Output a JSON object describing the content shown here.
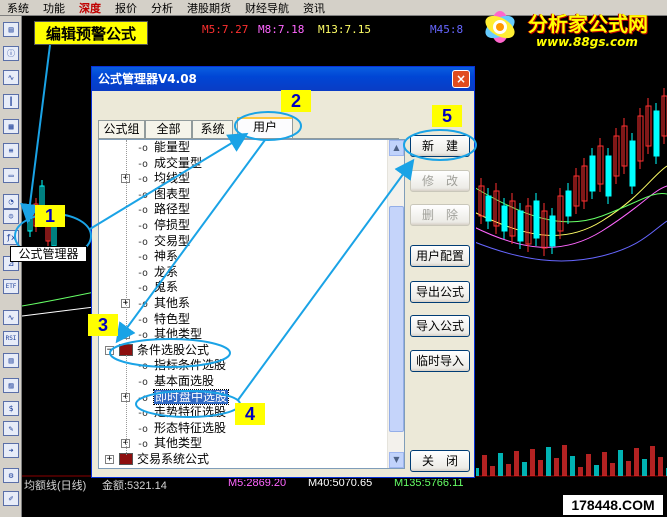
{
  "menubar": {
    "items": [
      "系统",
      "功能",
      "深度",
      "报价",
      "分析",
      "港股期货",
      "财经导航",
      "资讯"
    ]
  },
  "chart": {
    "ma_header": [
      {
        "text": "M5:7.27",
        "color": "#ff3030"
      },
      {
        "text": "M8:7.18",
        "color": "#ff66ff"
      },
      {
        "text": "M13:7.15",
        "color": "#ffff66"
      },
      {
        "text": "M45:8",
        "color": "#6666ff"
      }
    ]
  },
  "statusbar": {
    "label": "均额线(日线)",
    "amount": "金额:5321.14",
    "m5": "M5:2869.20",
    "m40": "M40:5070.65",
    "m135": "M135:5766.11"
  },
  "logo": {
    "name": "分析家公式网",
    "url": "www.88gs.com"
  },
  "watermark": "178448.COM",
  "dialog": {
    "title": "公式管理器V4.08",
    "close_icon": "×",
    "tabs": [
      "公式组",
      "全部",
      "系统",
      "用户"
    ],
    "active_tab": "用户",
    "buttons": {
      "new": "新　建",
      "edit": "修　改",
      "delete": "删　除",
      "user_config": "用户配置",
      "export": "导出公式",
      "import": "导入公式",
      "temp_import": "临时导入",
      "close": "关　闭"
    },
    "tree": [
      {
        "label": "能量型",
        "key": "-o",
        "expander": ""
      },
      {
        "label": "成交量型",
        "key": "-o",
        "expander": ""
      },
      {
        "label": "均线型",
        "key": "-o",
        "expander": "+"
      },
      {
        "label": "图表型",
        "key": "-o",
        "expander": ""
      },
      {
        "label": "路径型",
        "key": "-o",
        "expander": ""
      },
      {
        "label": "停损型",
        "key": "-o",
        "expander": ""
      },
      {
        "label": "交易型",
        "key": "-o",
        "expander": ""
      },
      {
        "label": "神系",
        "key": "-o",
        "expander": ""
      },
      {
        "label": "龙系",
        "key": "-o",
        "expander": ""
      },
      {
        "label": "鬼系",
        "key": "-o",
        "expander": ""
      },
      {
        "label": "其他系",
        "key": "-o",
        "expander": "+"
      },
      {
        "label": "特色型",
        "key": "-o",
        "expander": ""
      },
      {
        "label": "其他类型",
        "key": "-o",
        "expander": "+"
      },
      {
        "label": "条件选股公式",
        "key": "",
        "expander": "-"
      },
      {
        "label": "指标条件选股",
        "key": "-o",
        "expander": ""
      },
      {
        "label": "基本面选股",
        "key": "-o",
        "expander": ""
      },
      {
        "label": "即时盘中选股",
        "key": "-o",
        "expander": "+",
        "selected": true
      },
      {
        "label": "走势特征选股",
        "key": "-o",
        "expander": ""
      },
      {
        "label": "形态特征选股",
        "key": "-o",
        "expander": ""
      },
      {
        "label": "其他类型",
        "key": "-o",
        "expander": "+"
      },
      {
        "label": "交易系统公式",
        "key": "",
        "expander": "+"
      }
    ]
  },
  "annotations": {
    "title": "编辑预警公式",
    "formula_manager_label": "公式管理器",
    "steps": [
      "1",
      "2",
      "3",
      "4",
      "5"
    ]
  },
  "toolbar_icons": [
    "table-icon",
    "info-icon",
    "line-chart-icon",
    "candle-icon",
    "grid-icon",
    "list-icon",
    "doc-icon",
    "pie-icon",
    "people-icon",
    "formula-fx-icon",
    "ruler-icon",
    "etf-icon",
    "wave-icon",
    "rsi-icon",
    "layout-icon",
    "chart-icon",
    "dollar-icon",
    "pen-icon",
    "arrow-icon",
    "gear-icon",
    "edit-icon"
  ],
  "colors": {
    "accent_yellow": "#ffff00",
    "arrow_blue": "#1aa3e6",
    "selection": "#316ac5"
  }
}
